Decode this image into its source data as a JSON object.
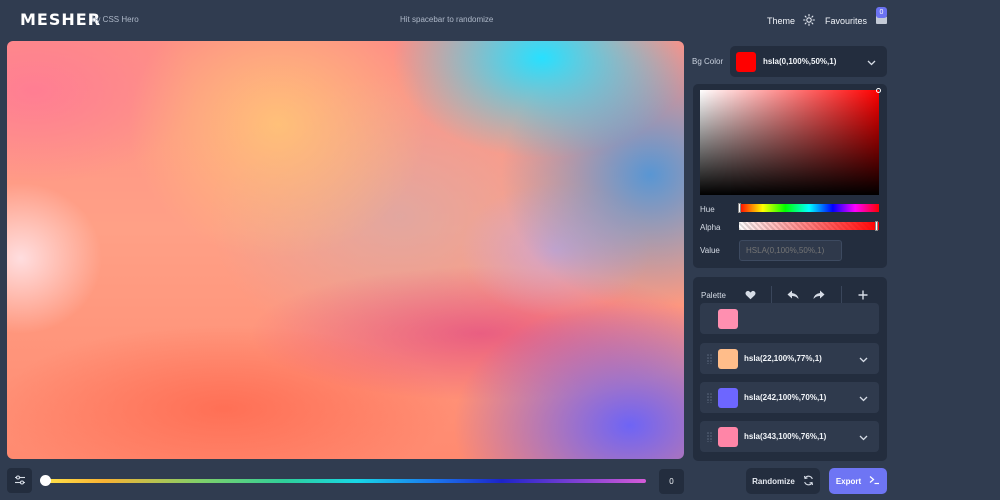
{
  "header": {
    "logo": "MESHER",
    "byline": "by CSS Hero",
    "hint": "Hit spacebar to randomize",
    "theme_label": "Theme",
    "favourites_label": "Favourites",
    "favourites_count": "0"
  },
  "background": {
    "label": "Bg Color",
    "value": "hsla(0,100%,50%,1)",
    "color": "#ff0000"
  },
  "picker": {
    "hue_label": "Hue",
    "alpha_label": "Alpha",
    "value_label": "Value",
    "value_placeholder": "HSLA(0,100%,50%,1)",
    "hue": 0,
    "alpha": 1
  },
  "palette": {
    "title": "Palette",
    "items": [
      {
        "value": "",
        "color": "#ff8fb0"
      },
      {
        "value": "hsla(22,100%,77%,1)",
        "color": "#ffbd8a"
      },
      {
        "value": "hsla(242,100%,70%,1)",
        "color": "#6d66ff"
      },
      {
        "value": "hsla(343,100%,76%,1)",
        "color": "#ff85a7"
      }
    ]
  },
  "bottom": {
    "slider_value": "0",
    "randomize_label": "Randomize",
    "export_label": "Export"
  },
  "icons": {
    "theme": "sun-icon",
    "favourites": "folder-icon",
    "palette_like": "heart-icon",
    "undo": "undo-icon",
    "redo": "redo-icon",
    "add": "plus-icon",
    "randomize": "refresh-icon",
    "export": "terminal-icon",
    "settings": "sliders-icon"
  }
}
